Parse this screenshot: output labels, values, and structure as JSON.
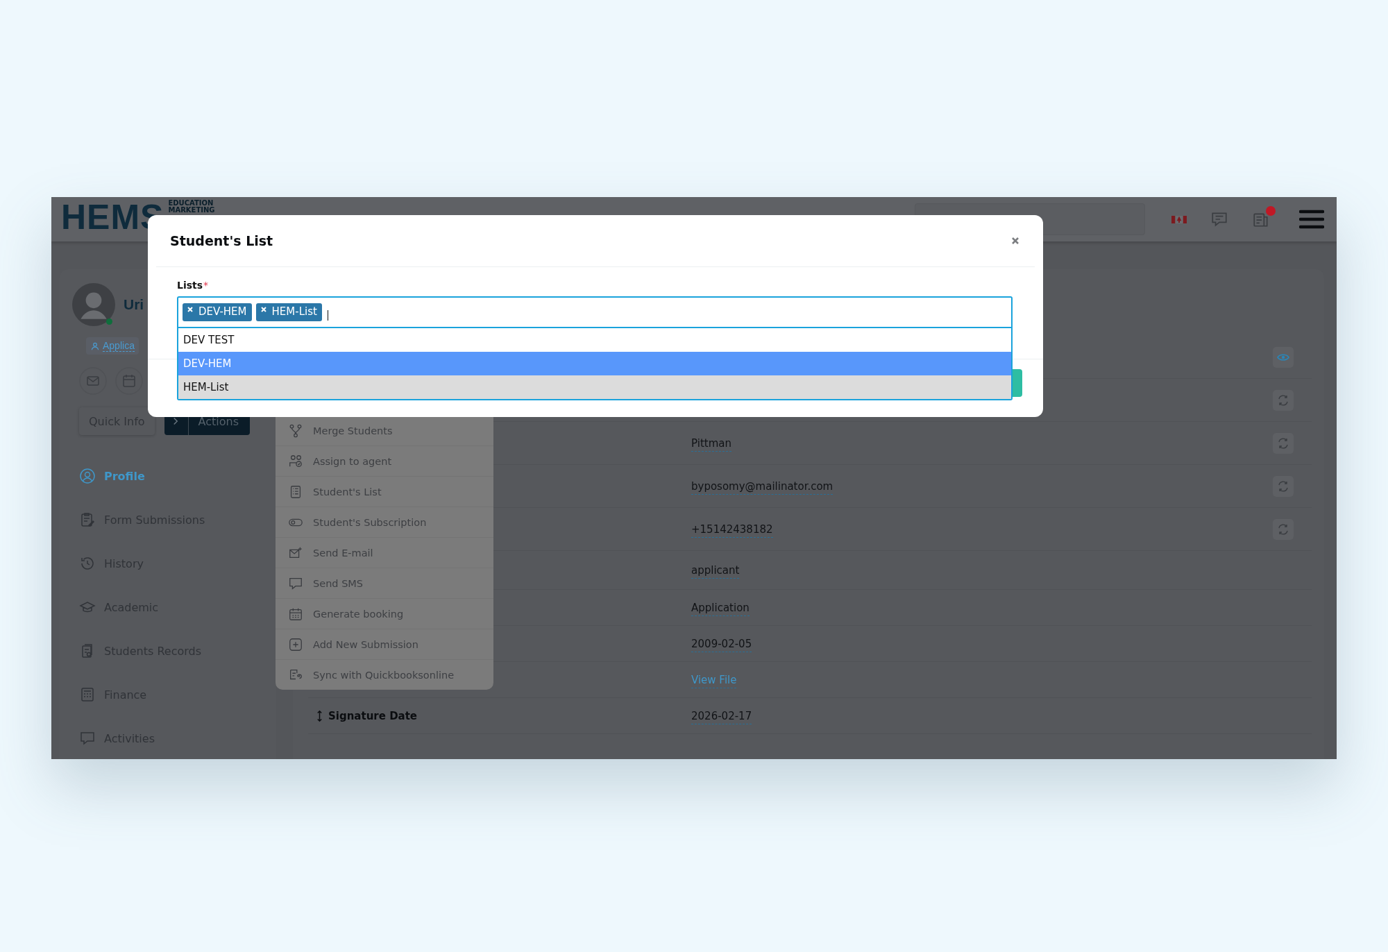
{
  "header": {
    "logo_text": "HEMS",
    "logo_tagline": [
      "EDUCATION",
      "MARKETING"
    ],
    "notifications_unread": true
  },
  "profile": {
    "name": "Uri",
    "status_badge": "Applica",
    "online": true
  },
  "profile_buttons": [
    {
      "label": "Quick Info",
      "kind": "plain"
    },
    {
      "label": "Actions",
      "kind": "split"
    }
  ],
  "sidebar": {
    "items": [
      {
        "label": "Profile",
        "selected": true
      },
      {
        "label": "Form Submissions",
        "selected": false
      },
      {
        "label": "History",
        "selected": false
      },
      {
        "label": "Academic",
        "selected": false
      },
      {
        "label": "Students Records",
        "selected": false
      },
      {
        "label": "Finance",
        "selected": false
      },
      {
        "label": "Activities",
        "selected": false
      }
    ]
  },
  "actions_menu": {
    "items": [
      {
        "label": "Merge Students"
      },
      {
        "label": "Assign to agent"
      },
      {
        "label": "Student's List"
      },
      {
        "label": "Student's Subscription"
      },
      {
        "label": "Send E-mail"
      },
      {
        "label": "Send SMS"
      },
      {
        "label": "Generate booking"
      },
      {
        "label": "Add New Submission"
      },
      {
        "label": "Sync with Quickbooksonline"
      }
    ]
  },
  "details": {
    "rows": [
      {
        "kind": "viewable"
      },
      {
        "kind": "syncable"
      },
      {
        "value": "Pittman",
        "kind": "syncable"
      },
      {
        "value": "byposomy@mailinator.com",
        "kind": "syncable"
      },
      {
        "value": "+15142438182",
        "kind": "syncable"
      },
      {
        "value": "applicant",
        "kind": "plain"
      },
      {
        "value": "Application",
        "kind": "plain"
      },
      {
        "value": "2009-02-05",
        "kind": "plain"
      },
      {
        "value": "View File",
        "kind": "link"
      },
      {
        "label": "Signature Date",
        "value": "2026-02-17",
        "kind": "plain"
      }
    ]
  },
  "modal": {
    "title": "Student's List",
    "field_label": "Lists",
    "required_mark": "*",
    "tags": [
      "DEV-HEM",
      "HEM-List"
    ],
    "options": [
      {
        "label": "DEV TEST",
        "selected": false,
        "highlighted": false
      },
      {
        "label": "DEV-HEM",
        "selected": true,
        "highlighted": true
      },
      {
        "label": "HEM-List",
        "selected": true,
        "highlighted": false
      }
    ]
  }
}
